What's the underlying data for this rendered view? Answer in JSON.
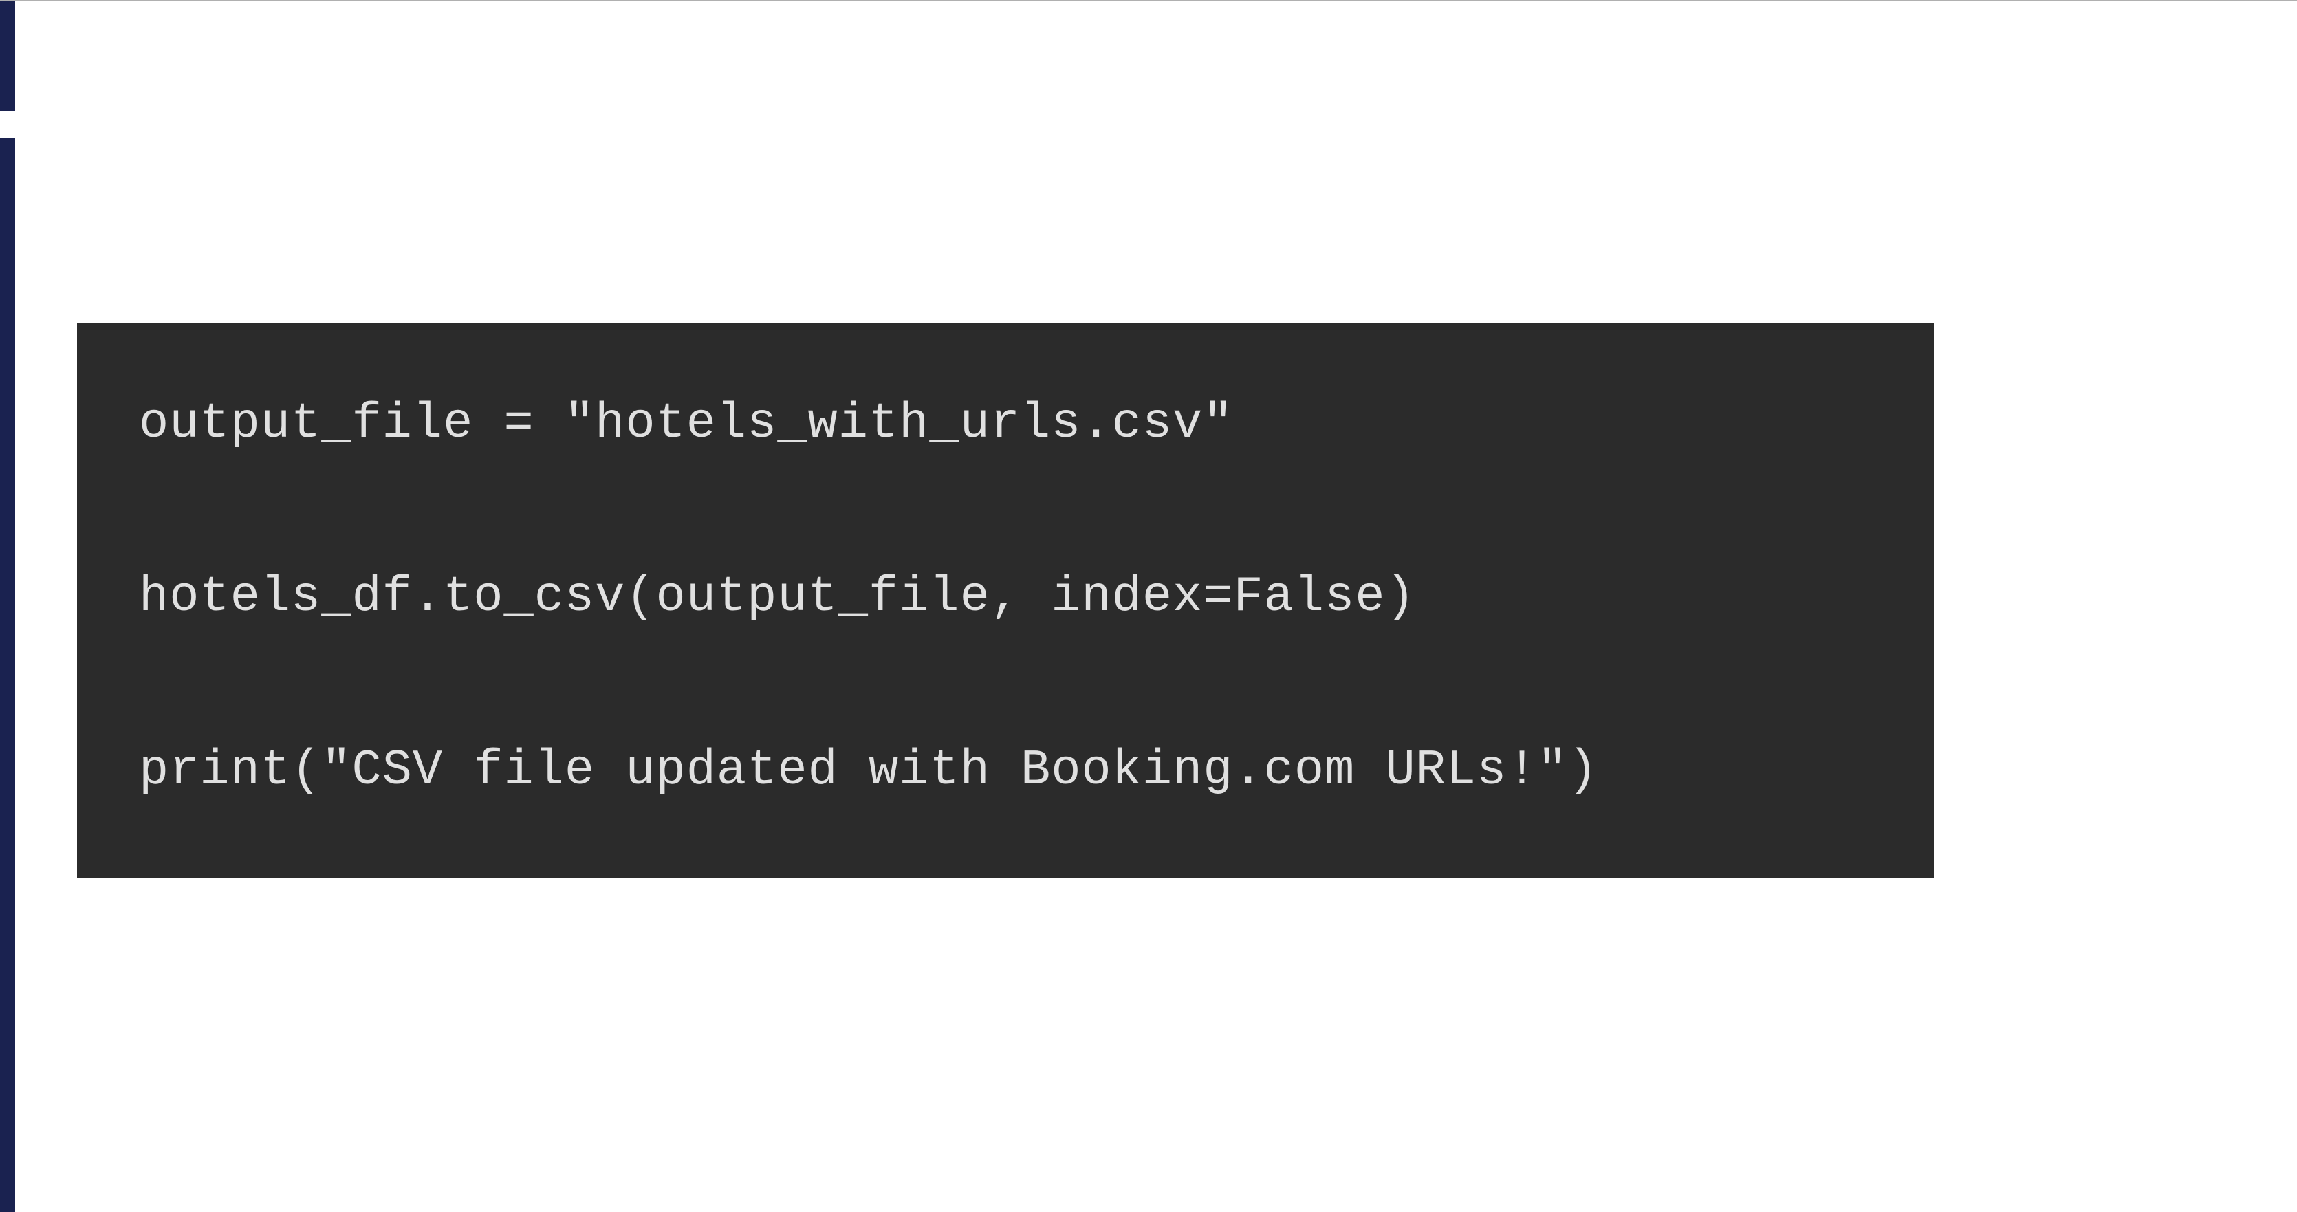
{
  "code": {
    "lines": [
      "output_file = \"hotels_with_urls.csv\"",
      "hotels_df.to_csv(output_file, index=False)",
      "print(\"CSV file updated with Booking.com URLs!\")"
    ]
  }
}
